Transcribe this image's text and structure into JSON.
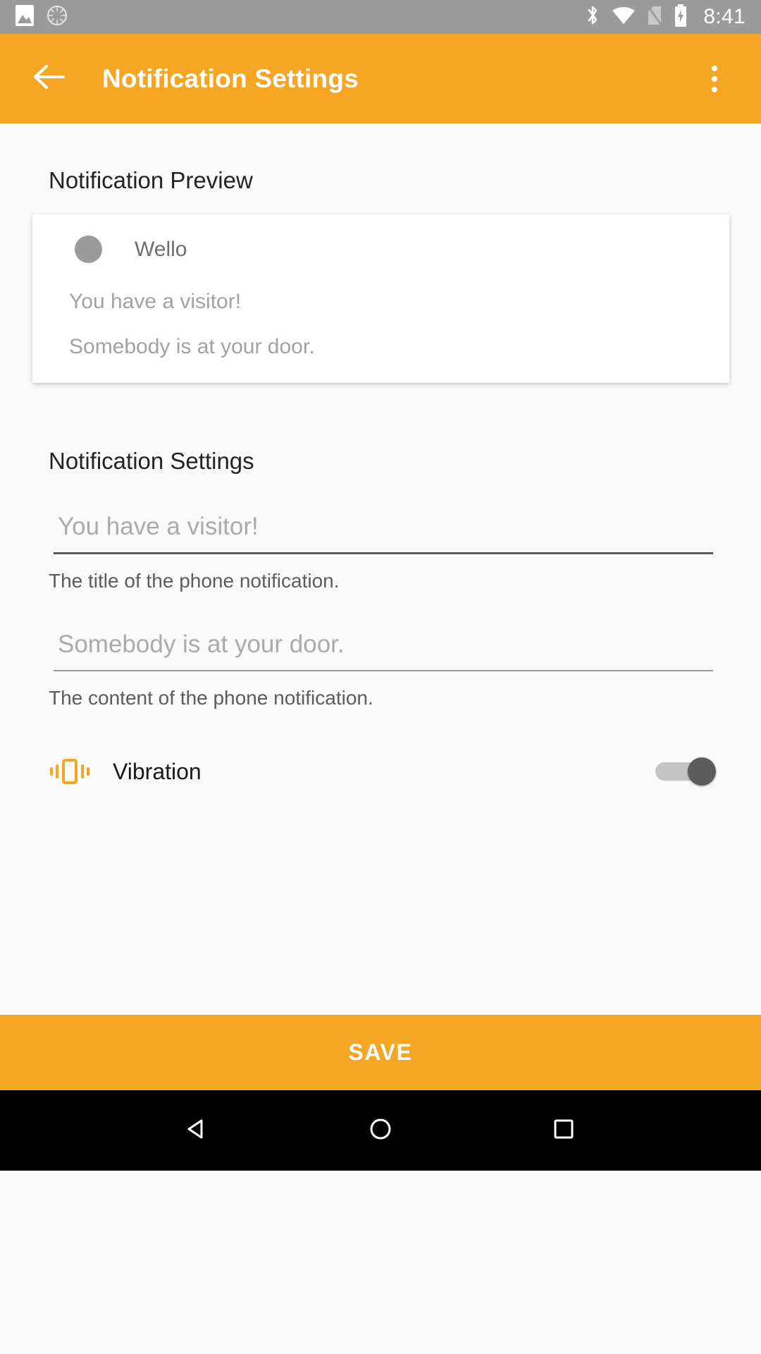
{
  "status_bar": {
    "time": "8:41",
    "icons_left": [
      "image-icon",
      "sync-spinner-icon"
    ],
    "icons_right": [
      "bluetooth-icon",
      "wifi-icon",
      "no-sim-icon",
      "battery-charging-icon"
    ],
    "background_color": "#9B9B9B"
  },
  "app_bar": {
    "title": "Notification Settings",
    "back_icon": "arrow-back-icon",
    "overflow_icon": "more-vert-icon",
    "background_color": "#F5A623"
  },
  "preview_section": {
    "header": "Notification Preview",
    "card": {
      "app_name": "Wello",
      "avatar_icon": "app-avatar-circle",
      "title_line": "You have a visitor!",
      "content_line": "Somebody is at your door."
    }
  },
  "settings_section": {
    "header": "Notification Settings",
    "fields": [
      {
        "value": "",
        "placeholder": "You have a visitor!",
        "helper": "The title of the phone notification."
      },
      {
        "value": "",
        "placeholder": "Somebody is at your door.",
        "helper": "The content of the phone notification."
      }
    ],
    "vibration": {
      "label": "Vibration",
      "icon": "vibration-icon",
      "enabled": true,
      "icon_color": "#F5A623"
    }
  },
  "save_button": {
    "label": "SAVE",
    "background_color": "#F5A623"
  },
  "nav_bar": {
    "back_icon": "nav-back-triangle-icon",
    "home_icon": "nav-home-circle-icon",
    "recents_icon": "nav-recents-square-icon"
  }
}
